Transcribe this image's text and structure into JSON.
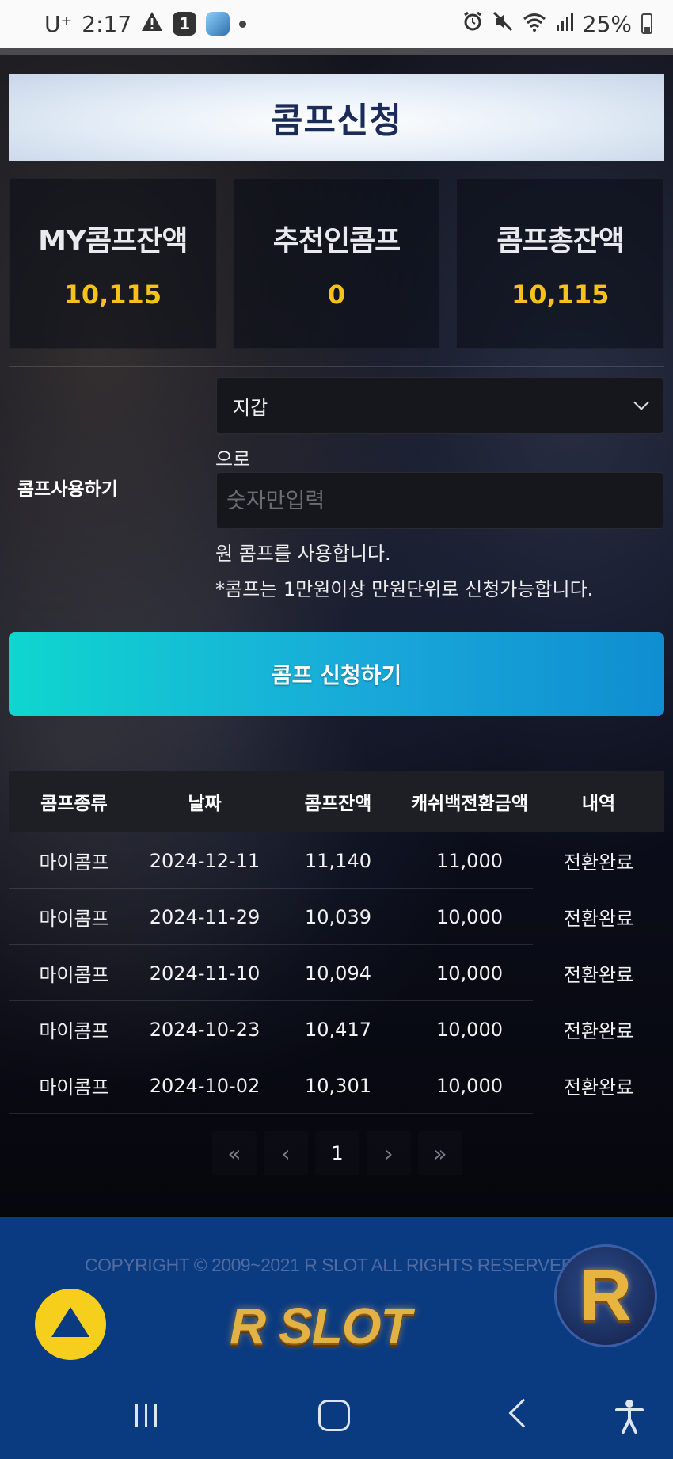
{
  "status_bar": {
    "carrier": "U⁺",
    "time": "2:17",
    "notification_count": "1",
    "battery": "25%"
  },
  "page": {
    "title": "콤프신청"
  },
  "stats": [
    {
      "label": "MY콤프잔액",
      "value": "10,115"
    },
    {
      "label": "추천인콤프",
      "value": "0"
    },
    {
      "label": "콤프총잔액",
      "value": "10,115"
    }
  ],
  "use_comp": {
    "label": "콤프사용하기",
    "selected_option": "지갑",
    "with_text": "으로",
    "amount_placeholder": "숫자만입력",
    "amount_value": "",
    "use_text": "원 콤프를 사용합니다.",
    "notice": "*콤프는 1만원이상 만원단위로 신청가능합니다."
  },
  "apply_button": "콤프 신청하기",
  "history": {
    "columns": [
      "콤프종류",
      "날짜",
      "콤프잔액",
      "캐쉬백전환금액",
      "내역"
    ],
    "rows": [
      [
        "마이콤프",
        "2024-12-11",
        "11,140",
        "11,000",
        "전환완료"
      ],
      [
        "마이콤프",
        "2024-11-29",
        "10,039",
        "10,000",
        "전환완료"
      ],
      [
        "마이콤프",
        "2024-11-10",
        "10,094",
        "10,000",
        "전환완료"
      ],
      [
        "마이콤프",
        "2024-10-23",
        "10,417",
        "10,000",
        "전환완료"
      ],
      [
        "마이콤프",
        "2024-10-02",
        "10,301",
        "10,000",
        "전환완료"
      ]
    ]
  },
  "pagination": {
    "first": "«",
    "prev": "‹",
    "current": "1",
    "next": "›",
    "last": "»"
  },
  "footer": {
    "copyright": "COPYRIGHT © 2009~2021 R SLOT ALL RIGHTS RESERVED",
    "logo": "R SLOT",
    "badge": "R"
  },
  "colors": {
    "accent_gold": "#f6c11a",
    "button_start": "#0fd6cf",
    "button_end": "#0f8ed1",
    "footer_blue": "#0a3a80"
  }
}
